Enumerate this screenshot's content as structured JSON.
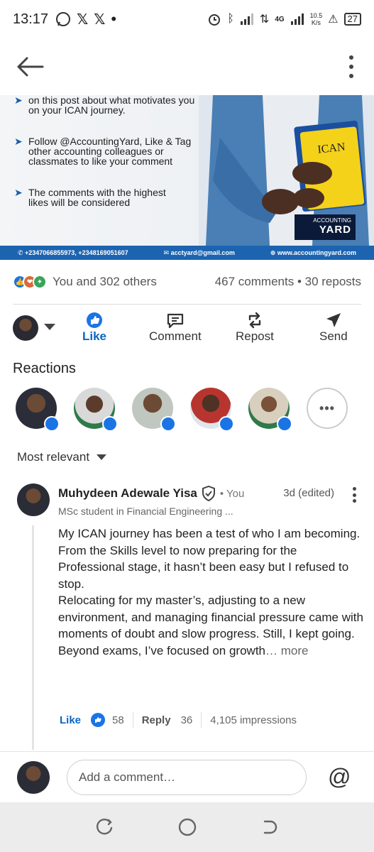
{
  "status_bar": {
    "time": "13:17",
    "network_speed_top": "10.5",
    "network_speed_bottom": "K/s",
    "network_type": "4G",
    "battery": "27"
  },
  "post_image": {
    "bullets": [
      "on this post about what motivates you on your ICAN journey.",
      "Follow @AccountingYard, Like & Tag other accounting colleagues or classmates to like your comment",
      "The comments with the highest likes will be considered"
    ],
    "brand_top": "ACCOUNTING",
    "brand_bottom": "YARD",
    "book_label": "ICAN",
    "phone": "+2347066855973, +2348169051607",
    "email": "acctyard@gmail.com",
    "website": "www.accountingyard.com"
  },
  "counts": {
    "reactions_text": "You and 302 others",
    "comments_reposts": "467 comments • 30 reposts"
  },
  "actions": {
    "like": "Like",
    "comment": "Comment",
    "repost": "Repost",
    "send": "Send"
  },
  "reactions_title": "Reactions",
  "more_reactions": "•••",
  "sort_label": "Most relevant",
  "comment": {
    "author": "Muhydeen Adewale Yisa",
    "you_label": "• You",
    "time": "3d (edited)",
    "headline": "MSc student in Financial Engineering ...",
    "paragraphs": [
      "My ICAN journey has been a test of who I am becoming.",
      "From the Skills level to now preparing for the Professional stage, it hasn’t been easy but I refused to stop.",
      "Relocating for my master’s, adjusting to a new environment, and managing financial pressure came with moments of doubt and slow progress. Still, I kept going.",
      "Beyond exams, I’ve focused on growth"
    ],
    "more_label": "… more",
    "like_label": "Like",
    "like_count": "58",
    "reply_label": "Reply",
    "reply_count": "36",
    "impressions": "4,105 impressions"
  },
  "add_comment": {
    "placeholder": "Add a comment…",
    "at_symbol": "@"
  },
  "colors": {
    "linkedin_blue": "#0a66c2",
    "reaction_blue": "#1b74e4",
    "nav_bg": "#ececec"
  }
}
